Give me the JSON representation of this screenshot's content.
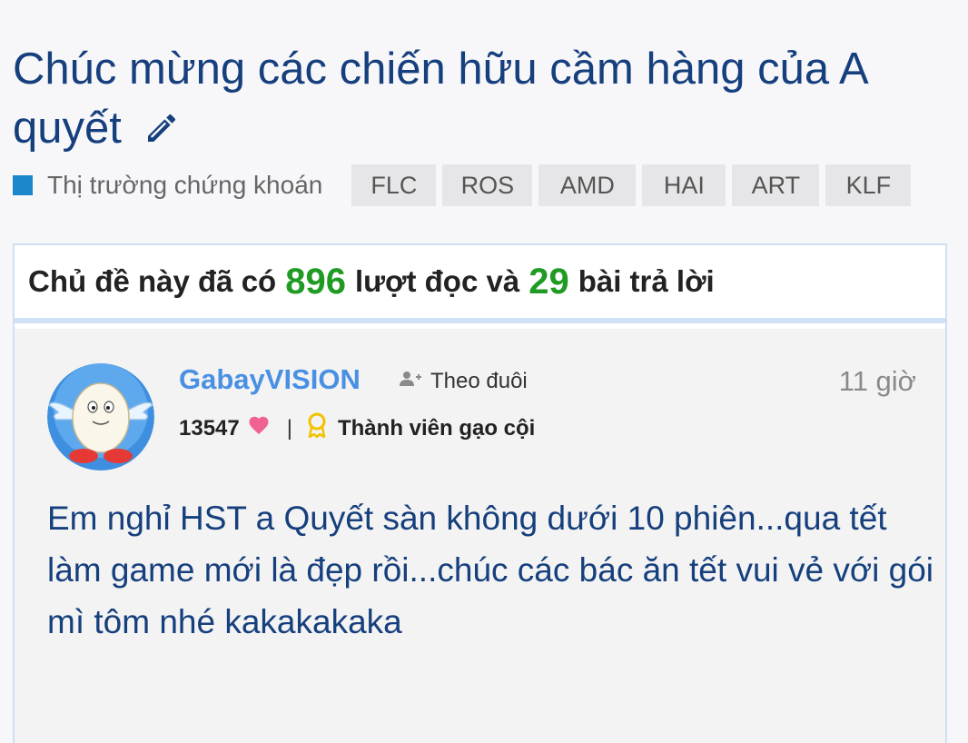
{
  "thread": {
    "title": "Chúc mừng các chiến hữu cầm hàng của A quyết",
    "category": "Thị trường chứng khoán",
    "tags": [
      "FLC",
      "ROS",
      "AMD",
      "HAI",
      "ART",
      "KLF"
    ]
  },
  "stats": {
    "prefix": "Chủ đề này đã có",
    "views": "896",
    "middle": "lượt đọc và",
    "replies": "29",
    "suffix": "bài trả lời"
  },
  "post": {
    "username": "GabayVISION",
    "follow_label": "Theo đuôi",
    "time": "11 giờ",
    "score": "13547",
    "separator": "|",
    "rank": "Thành viên gạo cội",
    "content": "Em nghỉ HST a Quyết sàn không dưới 10 phiên...qua tết làm game mới là đẹp rồi...chúc các bác ăn tết vui vẻ với gói mì tôm nhé kakakakaka"
  },
  "icons": {
    "edit": "pencil-icon",
    "follow": "user-plus-icon",
    "score": "heart-icon",
    "rank": "medal-icon"
  },
  "colors": {
    "title": "#163f7d",
    "category_square": "#1b86c9",
    "username": "#4a90e2",
    "stat_numbers": "#1f9b23",
    "heart": "#f06292",
    "medal": "#f2c200"
  }
}
